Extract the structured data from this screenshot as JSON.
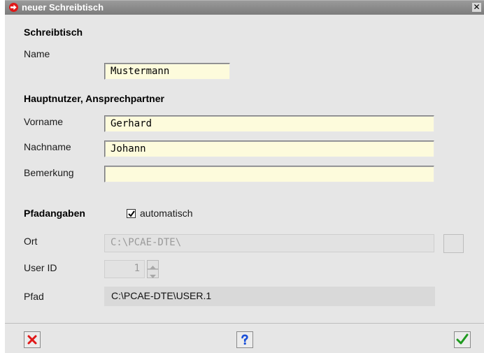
{
  "window": {
    "title": "neuer Schreibtisch",
    "close_glyph": "✕"
  },
  "sections": {
    "schreibtisch": "Schreibtisch",
    "hauptnutzer": "Hauptnutzer, Ansprechpartner",
    "pfadangaben": "Pfadangaben"
  },
  "fields": {
    "name": {
      "label": "Name",
      "value": "Mustermann"
    },
    "vorname": {
      "label": "Vorname",
      "value": "Gerhard"
    },
    "nachname": {
      "label": "Nachname",
      "value": "Johann"
    },
    "bemerkung": {
      "label": "Bemerkung",
      "value": ""
    },
    "ort": {
      "label": "Ort",
      "value": "C:\\PCAE-DTE\\"
    },
    "user_id": {
      "label": "User ID",
      "value": "1"
    },
    "pfad": {
      "label": "Pfad",
      "value": "C:\\PCAE-DTE\\USER.1"
    }
  },
  "automatisch": {
    "label": "automatisch",
    "checked": true
  },
  "buttons": {
    "cancel": "cancel-x-icon",
    "help": "help-question-icon",
    "ok": "ok-check-icon"
  },
  "colors": {
    "title_icon": "#e01818",
    "field_bg": "#fdfbdc",
    "cancel": "#e01818",
    "help": "#1a4fd8",
    "ok": "#1f9a1f"
  }
}
